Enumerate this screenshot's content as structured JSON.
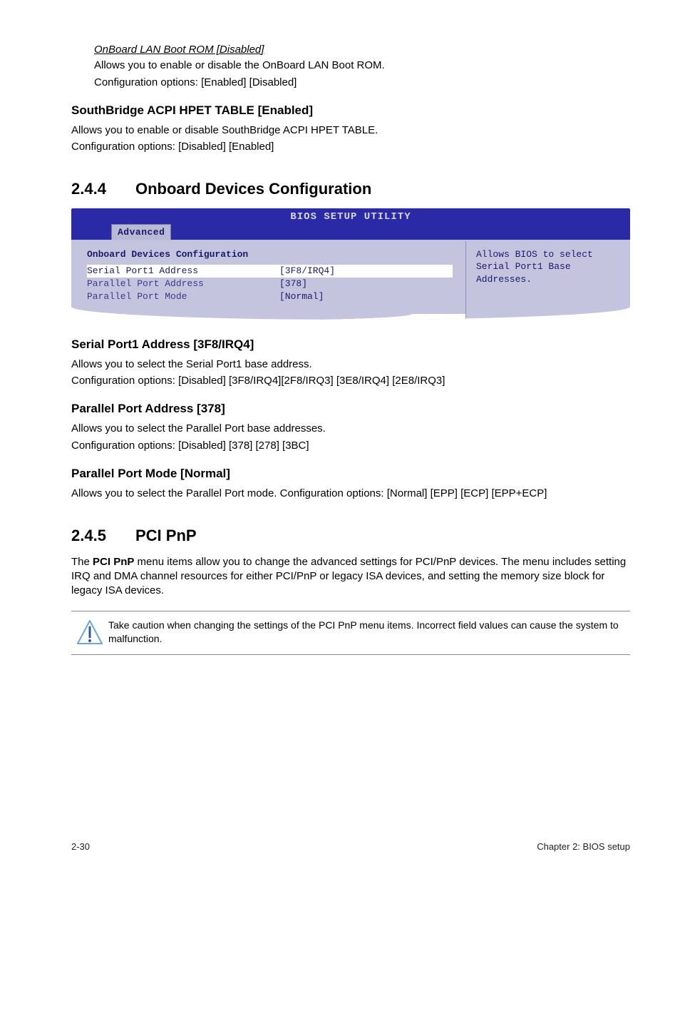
{
  "intro": {
    "subhead": "OnBoard LAN Boot ROM [Disabled]",
    "line1": "Allows you to enable or disable the OnBoard LAN Boot ROM.",
    "line2": "Configuration options: [Enabled] [Disabled]"
  },
  "sb": {
    "heading": "SouthBridge ACPI HPET TABLE [Enabled]",
    "line1": "Allows you to enable or disable SouthBridge ACPI HPET TABLE.",
    "line2": "Configuration options: [Disabled] [Enabled]"
  },
  "sec244": {
    "num": "2.4.4",
    "title": "Onboard Devices Configuration"
  },
  "bios": {
    "header": "BIOS SETUP UTILITY",
    "tab": "Advanced",
    "panel_title": "Onboard Devices Configuration",
    "rows": [
      {
        "label": "Serial Port1 Address",
        "value": "[3F8/IRQ4]",
        "selected": true
      },
      {
        "label": "Parallel Port Address",
        "value": "[378]",
        "selected": false
      },
      {
        "label": "Parallel Port Mode",
        "value": "[Normal]",
        "selected": false
      }
    ],
    "help": {
      "line1": "Allows BIOS to select",
      "line2": "Serial Port1 Base",
      "line3": "Addresses."
    }
  },
  "sp1": {
    "heading": "Serial Port1 Address [3F8/IRQ4]",
    "line1": "Allows you to select the Serial Port1 base address.",
    "line2": "Configuration options: [Disabled] [3F8/IRQ4][2F8/IRQ3] [3E8/IRQ4] [2E8/IRQ3]"
  },
  "ppa": {
    "heading": "Parallel Port Address [378]",
    "line1": "Allows you to select the Parallel Port base addresses.",
    "line2": "Configuration options: [Disabled] [378] [278] [3BC]"
  },
  "ppm": {
    "heading": "Parallel Port Mode [Normal]",
    "line1": "Allows you to select the Parallel Port  mode. Configuration options: [Normal] [EPP] [ECP] [EPP+ECP]"
  },
  "sec245": {
    "num": "2.4.5",
    "title": "PCI PnP",
    "body": "The PCI PnP menu items allow you to change the advanced settings for PCI/PnP devices. The menu includes setting IRQ and DMA channel resources for either PCI/PnP or legacy ISA devices, and setting the memory size block for legacy ISA devices.",
    "body_lead": "PCI PnP"
  },
  "caution": {
    "text": "Take caution when changing the settings of the PCI PnP menu items. Incorrect field values can cause the system to malfunction."
  },
  "footer": {
    "left": "2-30",
    "right": "Chapter 2: BIOS setup"
  }
}
